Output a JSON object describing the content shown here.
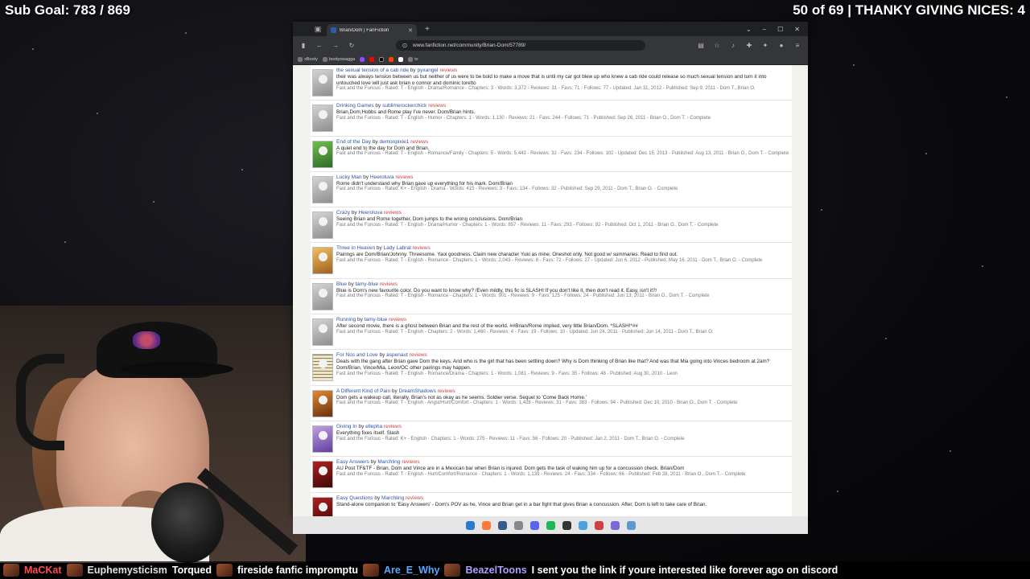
{
  "overlay": {
    "sub_goal": "Sub Goal: 783 / 869",
    "top_right": "50 of 69 | THANKY GIVING NICES: 4"
  },
  "browser": {
    "tab_title": "Brian/Dom | FanFiction",
    "url": "www.fanfiction.net/community/Brian-Dom/57789/",
    "bookmarks": [
      "xBooty",
      "bootyswagga",
      "tv"
    ]
  },
  "stories": [
    {
      "title": "the sexual tension of a cab ride",
      "author": "pyxangel",
      "reviews": "reviews",
      "thumb": "grey",
      "summary": "their was always tension between us but neither of us were to be bold to make a move that is until my car got blew up who knew a cab ride could release so much sexual tension and turn it into untouched love will just ask brian o connor and dominic toretto",
      "meta": "Fast and the Furious - Rated: T - English - Drama/Romance - Chapters: 3 - Words: 3,372 - Reviews: 31 - Favs: 71 - Follows: 77 - Updated: Jan 31, 2012 - Published: Sep 9, 2011 - Dom T., Brian O."
    },
    {
      "title": "Drinking Games",
      "author": "sublimerockerchick",
      "reviews": "reviews",
      "thumb": "grey",
      "summary": "Brian,Dom,Hobbs and Rome play I've never. Dom/Brian hints.",
      "meta": "Fast and the Furious - Rated: T - English - Humor - Chapters: 1 - Words: 1,130 - Reviews: 21 - Favs: 244 - Follows: 71 - Published: Sep 26, 2011 - Brian O., Dom T. - Complete"
    },
    {
      "title": "End of the Day",
      "author": "demonpixie1",
      "reviews": "reviews",
      "thumb": "green",
      "summary": "A quiet end to the day for Dom and Brian.",
      "meta": "Fast and the Furious - Rated: T - English - Romance/Family - Chapters: 5 - Words: 5,443 - Reviews: 32 - Favs: 234 - Follows: 102 - Updated: Dec 15, 2013 - Published: Aug 13, 2011 - Brian O., Dom T. - Complete"
    },
    {
      "title": "Lucky Man",
      "author": "Heeroluva",
      "reviews": "reviews",
      "thumb": "grey",
      "summary": "Rome didn't understand why Brian gave up everything for his mark. Dom/Brian",
      "meta": "Fast and the Furious - Rated: K+ - English - Drama - Words: 415 - Reviews: 3 - Favs: 134 - Follows: 32 - Published: Sep 29, 2011 - Dom T., Brian O. - Complete"
    },
    {
      "title": "Crazy",
      "author": "Heeroluva",
      "reviews": "reviews",
      "thumb": "grey",
      "summary": "Seeing Brian and Rome together, Dom jumps to the wrong conclusions. Dom/Brian",
      "meta": "Fast and the Furious - Rated: T - English - Drama/Humor - Chapters: 1 - Words: 857 - Reviews: 11 - Favs: 293 - Follows: 92 - Published: Oct 1, 2011 - Brian O., Dom T. - Complete"
    },
    {
      "title": "Three in Heaven",
      "author": "Lady Labrat",
      "reviews": "reviews",
      "thumb": "gold",
      "summary": "Pairings are Dom/Brian/Johnny. Threesome. Yaoi goodness. Claim new character Yuki as mine. Oneshot only. Not good w/ summaries. Read to find out.",
      "meta": "Fast and the Furious - Rated: T - English - Romance - Chapters: 1 - Words: 2,043 - Reviews: 8 - Favs: 72 - Follows: 27 - Updated: Jun 6, 2012 - Published: May 16, 2011 - Dom T., Brian O. - Complete"
    },
    {
      "title": "Blue",
      "author": "tamy-blue",
      "reviews": "reviews",
      "thumb": "grey",
      "summary": "Blue is Dom's new favourite color. Do you want to know why? /Even mildly, this fic is SLASH! If you don't like it, then don't read it. Easy, isn't it?/",
      "meta": "Fast and the Furious - Rated: T - English - Romance - Chapters: 1 - Words: 901 - Reviews: 9 - Favs: 125 - Follows: 24 - Published: Jun 13, 2011 - Brian O., Dom T. - Complete"
    },
    {
      "title": "Running",
      "author": "tamy-blue",
      "reviews": "reviews",
      "thumb": "grey",
      "summary": "After second movie, there is a ghost between Brian and the rest of the world. ##Brian/Rome implied, very little Brian/Dom. *SLASH!*##",
      "meta": "Fast and the Furious - Rated: T - English - Chapters: 2 - Words: 1,460 - Reviews: 4 - Favs: 19 - Follows: 10 - Updated: Jun 24, 2011 - Published: Jun 14, 2011 - Dom T., Brian O."
    },
    {
      "title": "For Nos and Love",
      "author": "aspenaut",
      "reviews": "reviews",
      "thumb": "text",
      "summary": "Deals with the gang after Brian gave Dom the keys. And who is the girl that has been settling down? Why is Dom thinking of Brian like that? And was that Mia going into Vinces bedroom at 2am? Dom/Brian, Vince/Mia, Leon/OC other pairings may happen.",
      "meta": "Fast and the Furious - Rated: T - English - Romance/Drama - Chapters: 1 - Words: 1,081 - Reviews: 9 - Favs: 35 - Follows: 48 - Published: Aug 30, 2010 - Leon"
    },
    {
      "title": "A Different Kind of Pain",
      "author": "DreamShadows",
      "reviews": "reviews",
      "thumb": "orange",
      "summary": "Dom gets a wakeup call, literally. Brian's not as okay as he seems. Soldier verse. Sequel to 'Come Back Home.'",
      "meta": "Fast and the Furious - Rated: T - English - Angst/Hurt/Comfort - Chapters: 1 - Words: 1,428 - Reviews: 31 - Favs: 383 - Follows: 94 - Published: Dec 10, 2010 - Brian O., Dom T. - Complete"
    },
    {
      "title": "Giving In",
      "author": "ellepha",
      "reviews": "reviews",
      "thumb": "purple",
      "summary": "Everything fixes itself. Slash",
      "meta": "Fast and the Furious - Rated: K+ - English - Chapters: 1 - Words: 275 - Reviews: 11 - Favs: 56 - Follows: 20 - Published: Jan 2, 2011 - Dom T., Brian O. - Complete"
    },
    {
      "title": "Easy Answers",
      "author": "Marchling",
      "reviews": "reviews",
      "thumb": "red",
      "summary": "AU Post TF&TF - Brian, Dom and Vince are in a Mexican bar when Brian is injured. Dom gets the task of waking him up for a concussion check. Brian/Dom",
      "meta": "Fast and the Furious - Rated: T - English - Hurt/Comfort/Romance - Chapters: 1 - Words: 1,139 - Reviews: 24 - Favs: 334 - Follows: 66 - Published: Feb 28, 2011 - Brian O., Dom T. - Complete"
    },
    {
      "title": "Easy Questions",
      "author": "Marchling",
      "reviews": "reviews",
      "thumb": "red",
      "summary": "Stand-alone companion to 'Easy Answers' - Dom's POV as he, Vince and Brian get in a bar fight that gives Brian a concussion. After, Dom is left to take care of Brian.",
      "meta": ""
    }
  ],
  "chat": [
    {
      "name": "MaCKat",
      "color": "#ff4d4d",
      "msg": ""
    },
    {
      "name": "Euphemysticism",
      "color": "#e0e0e0",
      "msg": "Torqued"
    },
    {
      "name": "fireside fanfic impromptu",
      "color": "#ffffff",
      "msg": ""
    },
    {
      "name": "Are_E_Why",
      "color": "#59a7ff",
      "msg": ""
    },
    {
      "name": "BeazelToons",
      "color": "#b29cff",
      "msg": "I sent you the link if youre interested like forever ago on discord"
    }
  ]
}
